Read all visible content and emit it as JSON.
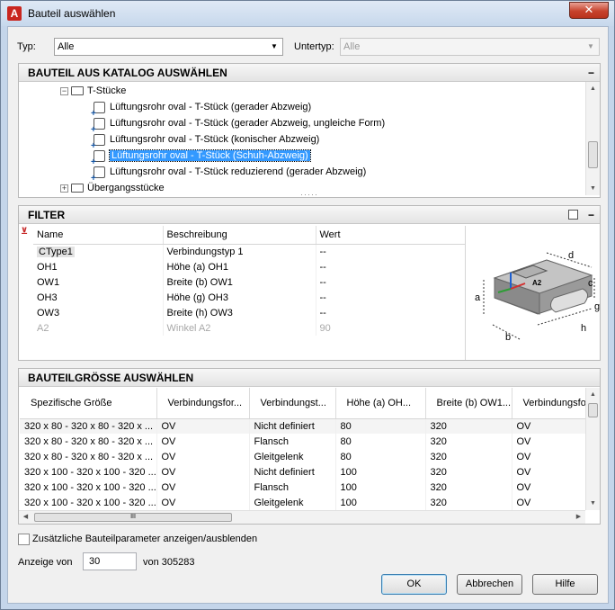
{
  "window": {
    "title": "Bauteil auswählen",
    "app_icon_letter": "A",
    "close_glyph": "✕"
  },
  "typ": {
    "label": "Typ:",
    "value": "Alle"
  },
  "untertyp": {
    "label": "Untertyp:",
    "value": "Alle"
  },
  "catalog": {
    "header": "BAUTEIL AUS KATALOG AUSWÄHLEN",
    "collapse": "−",
    "tree": [
      {
        "label": "T-Stücke",
        "kind": "folder-open",
        "expander": "−"
      },
      {
        "label": "Lüftungsrohr oval - T-Stück (gerader Abzweig)",
        "kind": "part"
      },
      {
        "label": "Lüftungsrohr oval - T-Stück (gerader Abzweig, ungleiche Form)",
        "kind": "part"
      },
      {
        "label": "Lüftungsrohr oval - T-Stück (konischer Abzweig)",
        "kind": "part"
      },
      {
        "label": "Lüftungsrohr oval - T-Stück (Schuh-Abzweig)",
        "kind": "part",
        "selected": true
      },
      {
        "label": "Lüftungsrohr oval - T-Stück reduzierend (gerader Abzweig)",
        "kind": "part"
      },
      {
        "label": "Übergangsstücke",
        "kind": "folder",
        "expander": "+"
      }
    ]
  },
  "filter": {
    "header": "FILTER",
    "collapse": "−",
    "columns": [
      "Name",
      "Beschreibung",
      "Wert"
    ],
    "rows": [
      {
        "name": "CType1",
        "desc": "Verbindungstyp 1",
        "value": "--"
      },
      {
        "name": "OH1",
        "desc": "Höhe (a) OH1",
        "value": "--"
      },
      {
        "name": "OW1",
        "desc": "Breite (b) OW1",
        "value": "--"
      },
      {
        "name": "OH3",
        "desc": "Höhe (g) OH3",
        "value": "--"
      },
      {
        "name": "OW3",
        "desc": "Breite (h) OW3",
        "value": "--"
      },
      {
        "name": "A2",
        "desc": "Winkel A2",
        "value": "90"
      }
    ],
    "preview_labels": {
      "a": "a",
      "b": "b",
      "c": "c",
      "d": "d",
      "g": "g",
      "h": "h",
      "angle": "A2"
    }
  },
  "size": {
    "header": "BAUTEILGRÖSSE AUSWÄHLEN",
    "columns": [
      "Spezifische Größe",
      "Verbindungsfor...",
      "Verbindungst...",
      "Höhe (a) OH...",
      "Breite (b) OW1...",
      "Verbindungsfor"
    ],
    "rows": [
      [
        "320 x 80 - 320 x 80 - 320 x ...",
        "OV",
        "Nicht definiert",
        "80",
        "320",
        "OV"
      ],
      [
        "320 x 80 - 320 x 80 - 320 x ...",
        "OV",
        "Flansch",
        "80",
        "320",
        "OV"
      ],
      [
        "320 x 80 - 320 x 80 - 320 x ...",
        "OV",
        "Gleitgelenk",
        "80",
        "320",
        "OV"
      ],
      [
        "320 x 100 - 320 x 100 - 320 ...",
        "OV",
        "Nicht definiert",
        "100",
        "320",
        "OV"
      ],
      [
        "320 x 100 - 320 x 100 - 320 ...",
        "OV",
        "Flansch",
        "100",
        "320",
        "OV"
      ],
      [
        "320 x 100 - 320 x 100 - 320 ...",
        "OV",
        "Gleitgelenk",
        "100",
        "320",
        "OV"
      ]
    ],
    "hscroll_grip": "III"
  },
  "toggle_params": {
    "label": "Zusätzliche Bauteilparameter anzeigen/ausblenden",
    "checked": false
  },
  "anzeige": {
    "label": "Anzeige von",
    "value": "30",
    "suffix": "von 305283"
  },
  "buttons": {
    "ok": "OK",
    "cancel": "Abbrechen",
    "help": "Hilfe"
  }
}
